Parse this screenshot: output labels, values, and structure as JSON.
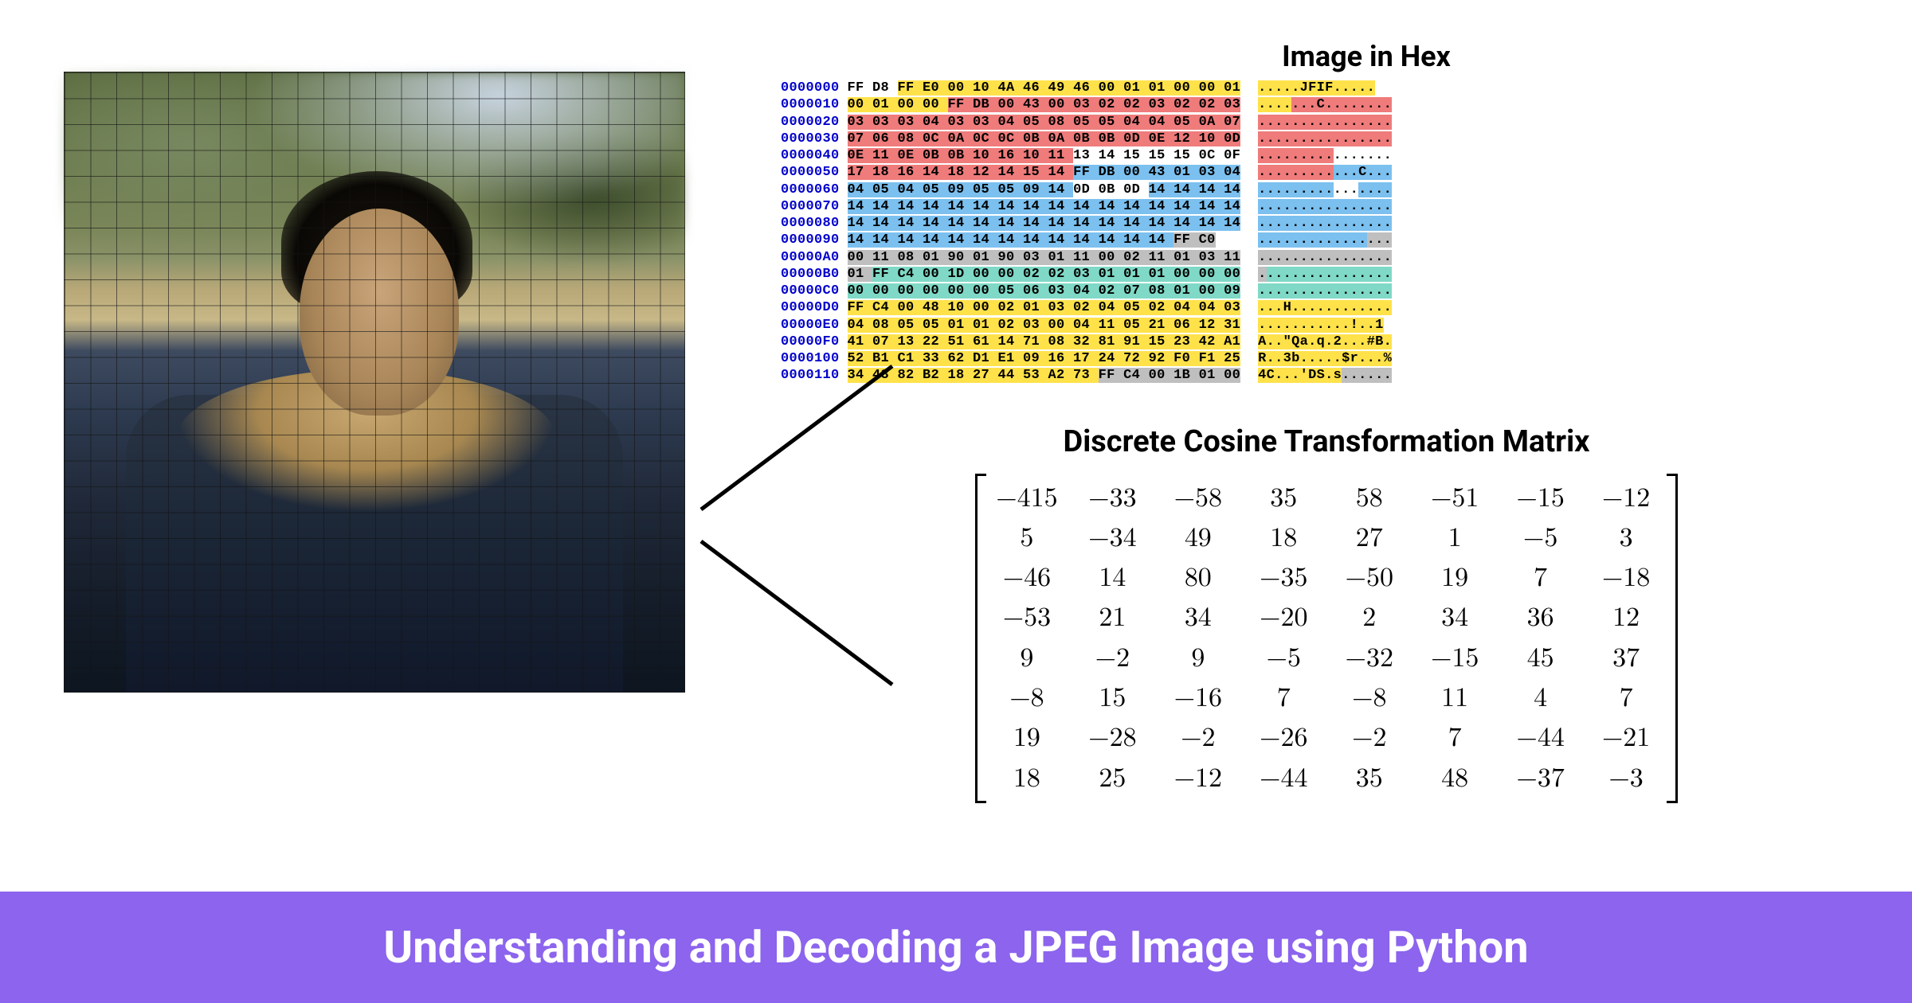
{
  "hex": {
    "title": "Image in Hex",
    "addresses": [
      "0000000",
      "0000010",
      "0000020",
      "0000030",
      "0000040",
      "0000050",
      "0000060",
      "0000070",
      "0000080",
      "0000090",
      "00000A0",
      "00000B0",
      "00000C0",
      "00000D0",
      "00000E0",
      "00000F0",
      "0000100",
      "0000110"
    ],
    "rows": [
      {
        "segs": [
          {
            "t": "FF D8 ",
            "c": "c-none"
          },
          {
            "t": "FF E0 00 10 4A 46 49 46 00 01 01 00 00 01",
            "c": "c-yel"
          }
        ],
        "ascii": [
          {
            "t": ".....JFIF.....",
            "c": "c-yel"
          }
        ]
      },
      {
        "segs": [
          {
            "t": "00 01 00 00 ",
            "c": "c-yel"
          },
          {
            "t": "FF DB 00 43 00 03 02 02 03 02 02 03",
            "c": "c-red"
          }
        ],
        "ascii": [
          {
            "t": "....",
            "c": "c-yel"
          },
          {
            "t": "...C........",
            "c": "c-red"
          }
        ]
      },
      {
        "segs": [
          {
            "t": "03 03 03 04 03 03 04 05 08 05 05 04 04 05 0A 07",
            "c": "c-red"
          }
        ],
        "ascii": [
          {
            "t": "................",
            "c": "c-red"
          }
        ]
      },
      {
        "segs": [
          {
            "t": "07 06 08 0C 0A 0C 0C 0B 0A 0B 0B 0D 0E 12 10 0D",
            "c": "c-red"
          }
        ],
        "ascii": [
          {
            "t": "................",
            "c": "c-red"
          }
        ]
      },
      {
        "segs": [
          {
            "t": "0E 11 0E 0B 0B 10 16 10 11 ",
            "c": "c-red"
          },
          {
            "t": "13 14 15 15 15 0C 0F",
            "c": "c-none"
          }
        ],
        "ascii": [
          {
            "t": ".........",
            "c": "c-red"
          },
          {
            "t": ".......",
            "c": "c-none"
          }
        ]
      },
      {
        "segs": [
          {
            "t": "17 18 16 14 18 12 14 15 14 ",
            "c": "c-red"
          },
          {
            "t": "FF DB 00 43 01 03 04",
            "c": "c-blue"
          }
        ],
        "ascii": [
          {
            "t": ".........",
            "c": "c-red"
          },
          {
            "t": "...C...",
            "c": "c-blue"
          }
        ]
      },
      {
        "segs": [
          {
            "t": "04 05 04 05 09 05 05 09 14 ",
            "c": "c-blue"
          },
          {
            "t": "0D 0B 0D ",
            "c": "c-none"
          },
          {
            "t": "14 14 14 14",
            "c": "c-blue"
          }
        ],
        "ascii": [
          {
            "t": ".........",
            "c": "c-blue"
          },
          {
            "t": "...",
            "c": "c-none"
          },
          {
            "t": "....",
            "c": "c-blue"
          }
        ]
      },
      {
        "segs": [
          {
            "t": "14 14 14 14 14 14 14 14 14 14 14 14 14 14 14 14",
            "c": "c-blue"
          }
        ],
        "ascii": [
          {
            "t": "................",
            "c": "c-blue"
          }
        ]
      },
      {
        "segs": [
          {
            "t": "14 14 14 14 14 14 14 14 14 14 14 14 14 14 14 14",
            "c": "c-blue"
          }
        ],
        "ascii": [
          {
            "t": "................",
            "c": "c-blue"
          }
        ]
      },
      {
        "segs": [
          {
            "t": "14 14 14 14 14 14 14 14 14 14 14 14 14 ",
            "c": "c-blue"
          },
          {
            "t": "FF C0",
            "c": "c-gray"
          }
        ],
        "ascii": [
          {
            "t": ".............",
            "c": "c-blue"
          },
          {
            "t": "...",
            "c": "c-gray"
          }
        ]
      },
      {
        "segs": [
          {
            "t": "00 11 08 01 90 01 90 03 01 11 00 02 11 01 03 11",
            "c": "c-gray"
          }
        ],
        "ascii": [
          {
            "t": "................",
            "c": "c-gray"
          }
        ]
      },
      {
        "segs": [
          {
            "t": "01 ",
            "c": "c-gray"
          },
          {
            "t": "FF C4 00 1D 00 00 02 02 03 01 01 01 00 00 00",
            "c": "c-teal"
          }
        ],
        "ascii": [
          {
            "t": ".",
            "c": "c-gray"
          },
          {
            "t": "...............",
            "c": "c-teal"
          }
        ]
      },
      {
        "segs": [
          {
            "t": "00 00 00 00 00 00 05 06 03 04 02 07 08 01 00 09",
            "c": "c-teal"
          }
        ],
        "ascii": [
          {
            "t": "................",
            "c": "c-teal"
          }
        ]
      },
      {
        "segs": [
          {
            "t": "FF C4 00 48 10 00 02 01 03 02 04 05 02 04 04 03",
            "c": "c-yel"
          }
        ],
        "ascii": [
          {
            "t": "...H............",
            "c": "c-yel"
          }
        ]
      },
      {
        "segs": [
          {
            "t": "04 08 05 05 01 01 02 03 00 04 11 05 21 06 12 31",
            "c": "c-yel"
          }
        ],
        "ascii": [
          {
            "t": "...........!..1",
            "c": "c-yel"
          }
        ]
      },
      {
        "segs": [
          {
            "t": "41 07 13 22 51 61 14 71 08 32 81 91 15 23 42 A1",
            "c": "c-yel"
          }
        ],
        "ascii": [
          {
            "t": "A..\"Qa.q.2...#B.",
            "c": "c-yel"
          }
        ]
      },
      {
        "segs": [
          {
            "t": "52 B1 C1 33 62 D1 E1 09 16 17 24 72 92 F0 F1 25",
            "c": "c-yel"
          }
        ],
        "ascii": [
          {
            "t": "R..3b.....$r...%",
            "c": "c-yel"
          }
        ]
      },
      {
        "segs": [
          {
            "t": "34 43 82 B2 18 27 44 53 A2 73 ",
            "c": "c-yel"
          },
          {
            "t": "FF C4 00 1B 01 00",
            "c": "c-gray"
          }
        ],
        "ascii": [
          {
            "t": "4C...'DS.s",
            "c": "c-yel"
          },
          {
            "t": "......",
            "c": "c-gray"
          }
        ]
      }
    ]
  },
  "dct": {
    "title": "Discrete Cosine Transformation Matrix",
    "matrix": [
      [
        "−415",
        "−33",
        "−58",
        "35",
        "58",
        "−51",
        "−15",
        "−12"
      ],
      [
        "5",
        "−34",
        "49",
        "18",
        "27",
        "1",
        "−5",
        "3"
      ],
      [
        "−46",
        "14",
        "80",
        "−35",
        "−50",
        "19",
        "7",
        "−18"
      ],
      [
        "−53",
        "21",
        "34",
        "−20",
        "2",
        "34",
        "36",
        "12"
      ],
      [
        "9",
        "−2",
        "9",
        "−5",
        "−32",
        "−15",
        "45",
        "37"
      ],
      [
        "−8",
        "15",
        "−16",
        "7",
        "−8",
        "11",
        "4",
        "7"
      ],
      [
        "19",
        "−28",
        "−2",
        "−26",
        "−2",
        "7",
        "−44",
        "−21"
      ],
      [
        "18",
        "25",
        "−12",
        "−44",
        "35",
        "48",
        "−37",
        "−3"
      ]
    ]
  },
  "footer": {
    "text": "Understanding and Decoding a JPEG Image using Python"
  },
  "colors": {
    "accent": "#8c64ed"
  }
}
